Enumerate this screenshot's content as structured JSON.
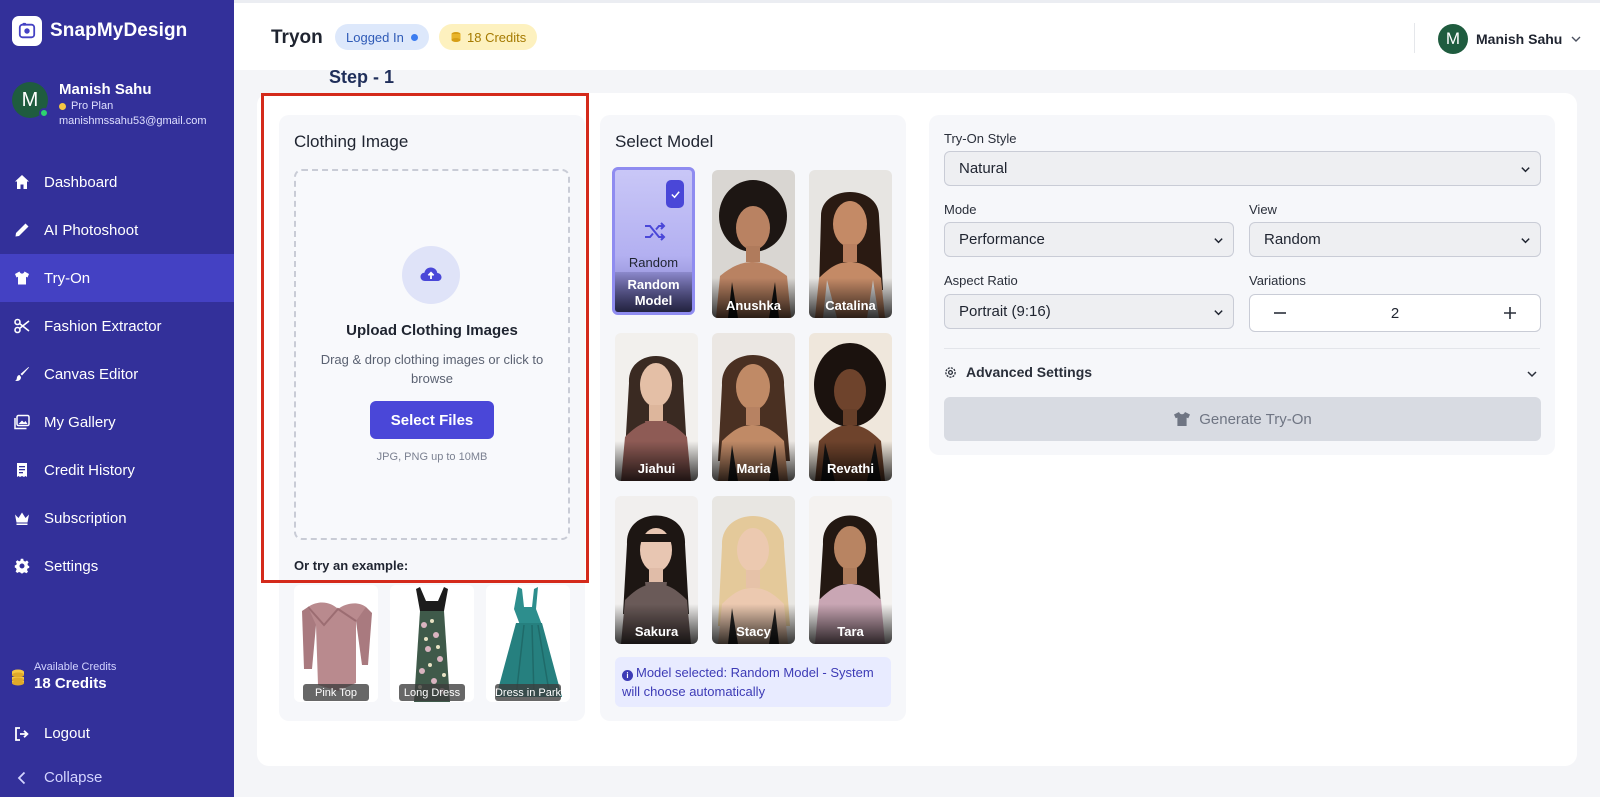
{
  "sidebar": {
    "brand_name": "SnapMyDesign",
    "profile": {
      "initial": "M",
      "name": "Manish Sahu",
      "plan": "Pro Plan",
      "email": "manishmssahu53@gmail.com"
    },
    "items": [
      {
        "label": "Dashboard",
        "icon": "home-icon",
        "active": false
      },
      {
        "label": "AI Photoshoot",
        "icon": "pencil-icon",
        "active": false
      },
      {
        "label": "Try-On",
        "icon": "tshirt-icon",
        "active": true
      },
      {
        "label": "Fashion Extractor",
        "icon": "scissors-icon",
        "active": false
      },
      {
        "label": "Canvas Editor",
        "icon": "brush-icon",
        "active": false
      },
      {
        "label": "My Gallery",
        "icon": "gallery-icon",
        "active": false
      },
      {
        "label": "Credit History",
        "icon": "receipt-icon",
        "active": false
      },
      {
        "label": "Subscription",
        "icon": "crown-icon",
        "active": false
      },
      {
        "label": "Settings",
        "icon": "gear-icon",
        "active": false
      }
    ],
    "credits_label": "Available Credits",
    "credits_value": "18 Credits",
    "logout_label": "Logout",
    "collapse_label": "Collapse"
  },
  "header": {
    "title": "Tryon",
    "status_badge": "Logged In",
    "credits_badge": "18 Credits",
    "user_initial": "M",
    "user_name": "Manish Sahu"
  },
  "step_label": "Step - 1",
  "clothing": {
    "title": "Clothing Image",
    "upload_title": "Upload Clothing Images",
    "upload_desc": "Drag & drop clothing images or click to browse",
    "select_files_label": "Select Files",
    "upload_hint": "JPG, PNG up to 10MB",
    "examples_title": "Or try an example:",
    "examples": [
      {
        "label": "Pink Top"
      },
      {
        "label": "Long Dress"
      },
      {
        "label": "Dress in Park"
      }
    ]
  },
  "models": {
    "title": "Select Model",
    "random_icon_text": "Random",
    "random_label": "Random Model",
    "items": [
      {
        "label": "Anushka"
      },
      {
        "label": "Catalina"
      },
      {
        "label": "Jiahui"
      },
      {
        "label": "Maria"
      },
      {
        "label": "Revathi"
      },
      {
        "label": "Sakura"
      },
      {
        "label": "Stacy"
      },
      {
        "label": "Tara"
      }
    ],
    "note": "Model selected: Random Model - System will choose automatically"
  },
  "settings": {
    "tryon_style": {
      "label": "Try-On Style",
      "value": "Natural"
    },
    "mode": {
      "label": "Mode",
      "value": "Performance"
    },
    "view": {
      "label": "View",
      "value": "Random"
    },
    "aspect_ratio": {
      "label": "Aspect Ratio",
      "value": "Portrait (9:16)"
    },
    "variations": {
      "label": "Variations",
      "value": "2"
    },
    "advanced_label": "Advanced Settings",
    "generate_label": "Generate Try-On"
  },
  "colors": {
    "sidebar_bg": "#33309a",
    "sidebar_active": "#4441c3",
    "accent": "#4a47d8",
    "highlight_border": "#d42a1b"
  }
}
